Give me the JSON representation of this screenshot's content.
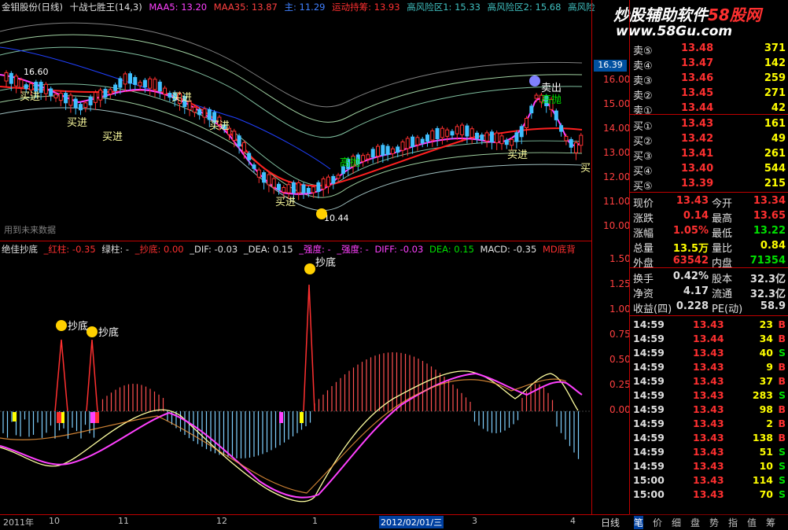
{
  "header": {
    "stock": "金钼股份(日线)",
    "indicator": "十战七胜王(14,3)",
    "ma5_label": "MAA5: 13.20",
    "ma35_label": "MAA35: 13.87",
    "extra1": "主: 11.29",
    "signal_label": "运动持筹: 13.93",
    "risk1": "高风险区1: 15.33",
    "risk2": "高风险区2: 15.68",
    "risk3": "高风险"
  },
  "upper_annotations": {
    "high_label": "16.60",
    "low_label": "10.44",
    "buy": "买进",
    "buy_short": "买",
    "sell": "卖出",
    "throw": "高抛",
    "future": "用到未来数据"
  },
  "upper_axis": [
    "16.00",
    "15.00",
    "14.00",
    "13.00",
    "12.00",
    "11.00",
    "10.00"
  ],
  "price_marker": "16.39",
  "lower_header": {
    "name": "绝佳抄底",
    "red": "_红柱: -0.35",
    "green": "绿柱: -",
    "chaodi": "_抄底: 0.00",
    "dif": "_DIF: -0.03",
    "dea": "_DEA: 0.15",
    "strong": "_强度: -",
    "strong2": "_强度: -",
    "diff": "DIFF: -0.03",
    "dea2": "DEA: 0.15",
    "macd": "MACD: -0.35",
    "md": "MD底背"
  },
  "lower_annotations": {
    "chaodi": "抄底"
  },
  "lower_axis": [
    "1.50",
    "1.25",
    "1.00",
    "0.75",
    "0.50",
    "0.25",
    "0.00"
  ],
  "x_axis": [
    "2011年",
    "10",
    "11",
    "12",
    "1",
    "2012/02/01/三",
    "3",
    "4"
  ],
  "period": "日线",
  "watermark": {
    "text": "炒股辅助软件",
    "brand": "58股网",
    "url": "www.58Gu.com"
  },
  "orderbook": {
    "sells": [
      {
        "label": "卖⑤",
        "price": "13.48",
        "vol": "371"
      },
      {
        "label": "卖④",
        "price": "13.47",
        "vol": "142"
      },
      {
        "label": "卖③",
        "price": "13.46",
        "vol": "259"
      },
      {
        "label": "卖②",
        "price": "13.45",
        "vol": "271"
      },
      {
        "label": "卖①",
        "price": "13.44",
        "vol": "42"
      }
    ],
    "buys": [
      {
        "label": "买①",
        "price": "13.43",
        "vol": "161"
      },
      {
        "label": "买②",
        "price": "13.42",
        "vol": "49"
      },
      {
        "label": "买③",
        "price": "13.41",
        "vol": "261"
      },
      {
        "label": "买④",
        "price": "13.40",
        "vol": "544"
      },
      {
        "label": "买⑤",
        "price": "13.39",
        "vol": "215"
      }
    ]
  },
  "stats": [
    {
      "k1": "现价",
      "v1": "13.43",
      "k2": "今开",
      "v2": "13.34"
    },
    {
      "k1": "涨跌",
      "v1": "0.14",
      "k2": "最高",
      "v2": "13.65"
    },
    {
      "k1": "涨幅",
      "v1": "1.05%",
      "k2": "最低",
      "v2": "13.22"
    },
    {
      "k1": "总量",
      "v1": "13.5万",
      "k2": "量比",
      "v2": "0.84"
    },
    {
      "k1": "外盘",
      "v1": "63542",
      "k2": "内盘",
      "v2": "71354"
    }
  ],
  "stats2": [
    {
      "k1": "换手",
      "v1": "0.42%",
      "k2": "股本",
      "v2": "32.3亿"
    },
    {
      "k1": "净资",
      "v1": "4.17",
      "k2": "流通",
      "v2": "32.3亿"
    },
    {
      "k1": "收益(四)",
      "v1": "0.228",
      "k2": "PE(动)",
      "v2": "58.9"
    }
  ],
  "ticks": [
    {
      "t": "14:59",
      "p": "13.43",
      "v": "23",
      "s": "B"
    },
    {
      "t": "14:59",
      "p": "13.44",
      "v": "34",
      "s": "B"
    },
    {
      "t": "14:59",
      "p": "13.43",
      "v": "40",
      "s": "S"
    },
    {
      "t": "14:59",
      "p": "13.43",
      "v": "9",
      "s": "B"
    },
    {
      "t": "14:59",
      "p": "13.43",
      "v": "37",
      "s": "B"
    },
    {
      "t": "14:59",
      "p": "13.43",
      "v": "283",
      "s": "S"
    },
    {
      "t": "14:59",
      "p": "13.43",
      "v": "98",
      "s": "B"
    },
    {
      "t": "14:59",
      "p": "13.43",
      "v": "2",
      "s": "B"
    },
    {
      "t": "14:59",
      "p": "13.43",
      "v": "138",
      "s": "B"
    },
    {
      "t": "14:59",
      "p": "13.43",
      "v": "51",
      "s": "S"
    },
    {
      "t": "14:59",
      "p": "13.43",
      "v": "10",
      "s": "S"
    },
    {
      "t": "15:00",
      "p": "13.43",
      "v": "114",
      "s": "S"
    },
    {
      "t": "15:00",
      "p": "13.43",
      "v": "70",
      "s": "S"
    }
  ],
  "tabs": [
    "笔",
    "价",
    "细",
    "盘",
    "势",
    "指",
    "值",
    "筹"
  ],
  "colors": {
    "red": "#ff3030",
    "green": "#00e000",
    "yellow": "#ffff00",
    "magenta": "#ff40ff",
    "cyan": "#40c0ff"
  }
}
